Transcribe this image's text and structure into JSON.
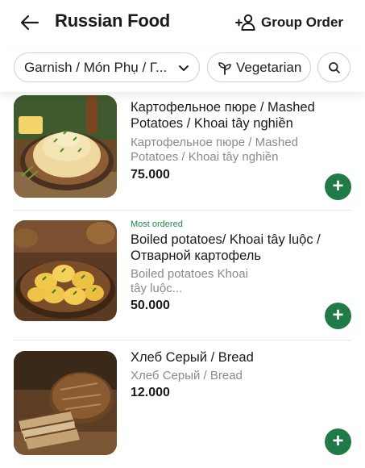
{
  "header": {
    "title": "Russian Food",
    "group_order_label": "Group Order",
    "back_icon": "arrow-left-icon",
    "group_icon": "add-people-icon"
  },
  "filters": {
    "category": "Garnish / Món Phụ / Г...",
    "vegetarian": "Vegetarian",
    "chevron_icon": "chevron-down-icon",
    "veg_icon": "sprout-icon",
    "search_icon": "search-icon"
  },
  "items": [
    {
      "badge": "",
      "name": "Картофельное пюре / Mashed Potatoes / Khoai tây nghiền",
      "description": "Картофельное пюре / Mashed Potatoes / Khoai tây nghiền",
      "price": "75.000"
    },
    {
      "badge": "Most ordered",
      "name": "Boiled potatoes/  Khoai tây luộc / Отварной картофель",
      "description": "Boiled potatoes Khoai tây luộc...",
      "price": "50.000"
    },
    {
      "badge": "",
      "name": "Хлеб Серый / Bread",
      "description": "Хлеб Серый / Bread",
      "price": "12.000"
    }
  ],
  "add_button_label": "+",
  "colors": {
    "accent_green": "#1f7a47",
    "badge_green": "#1f8a4c",
    "muted_text": "#8a8a8a"
  }
}
